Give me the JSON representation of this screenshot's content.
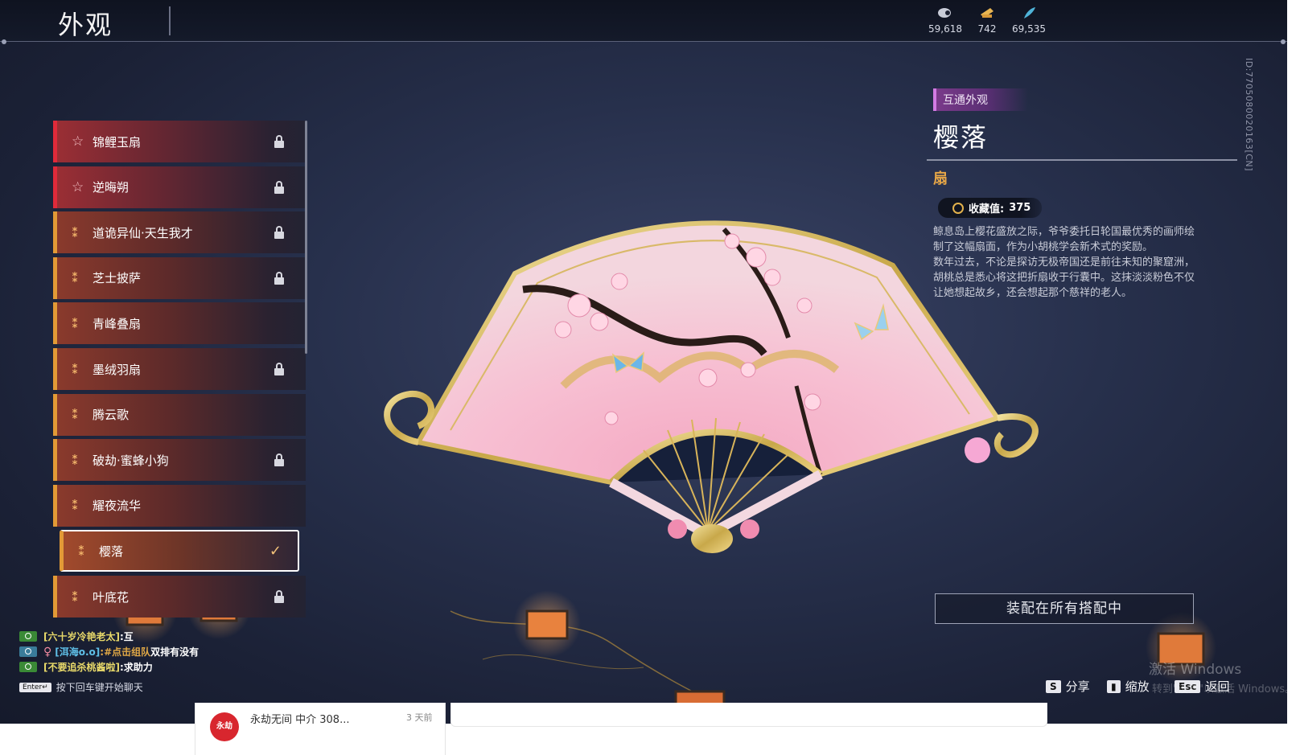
{
  "header": {
    "title": "外观",
    "currencies": [
      {
        "icon": "jade-currency-icon",
        "value": "59,618",
        "color": "#d8dbe6"
      },
      {
        "icon": "ticket-currency-icon",
        "value": "742",
        "color": "#e8b552"
      },
      {
        "icon": "feather-currency-icon",
        "value": "69,535",
        "color": "#4fb3d8"
      }
    ]
  },
  "skins": {
    "items": [
      {
        "label": "锦鲤玉扇",
        "rank": "star",
        "locked": true
      },
      {
        "label": "逆晦朔",
        "rank": "star",
        "locked": true
      },
      {
        "label": "道诡异仙·天生我才",
        "rank": "tier",
        "locked": true
      },
      {
        "label": "芝士披萨",
        "rank": "tier",
        "locked": true
      },
      {
        "label": "青峰叠扇",
        "rank": "tier",
        "locked": false
      },
      {
        "label": "墨绒羽扇",
        "rank": "tier",
        "locked": true
      },
      {
        "label": "腾云歌",
        "rank": "tier",
        "locked": false
      },
      {
        "label": "破劫·蜜蜂小狗",
        "rank": "tier",
        "locked": true
      },
      {
        "label": "耀夜流华",
        "rank": "tier",
        "locked": false
      },
      {
        "label": "樱落",
        "rank": "tier",
        "locked": false,
        "selected": true
      },
      {
        "label": "叶底花",
        "rank": "tier",
        "locked": true
      }
    ]
  },
  "detail": {
    "tag": "互通外观",
    "name": "樱落",
    "type": "扇",
    "collect_label": "收藏值:",
    "collect_value": "375",
    "description": "鲸息岛上樱花盛放之际，爷爷委托日轮国最优秀的画师绘制了这幅扇面，作为小胡桃学会新术式的奖励。\n数年过去，不论是探访无极帝国还是前往未知的聚窟洲，胡桃总是悉心将这把折扇收于行囊中。这抹淡淡粉色不仅让她想起故乡，还会想起那个慈祥的老人。",
    "id": "ID:7705080020163[CN]",
    "equip_all_label": "装配在所有搭配中"
  },
  "chat": {
    "lines": [
      {
        "name": "[六十岁冷艳老太]",
        "message": ":互",
        "badge": "green"
      },
      {
        "name": "[洱海o.o]",
        "link": ":#点击组队",
        "message": " 双排有没有",
        "badge": "blue",
        "gender": "♀"
      },
      {
        "name": "[不要追杀桃酱啦]",
        "message": ":求助力",
        "badge": "green"
      }
    ],
    "enter_key": "Enter↵",
    "hint": "按下回车键开始聊天"
  },
  "hotkeys": [
    {
      "key": "S",
      "label": "分享"
    },
    {
      "key": "▮",
      "label": "缩放"
    },
    {
      "key": "Esc",
      "label": "返回"
    }
  ],
  "watermark": {
    "line1": "激活 Windows",
    "line2": "转到\"设置\"以激活 Windows。"
  },
  "notification": {
    "avatar_text": "永劫",
    "text": "永劫无间 中介 308...",
    "time": "3 天前"
  }
}
